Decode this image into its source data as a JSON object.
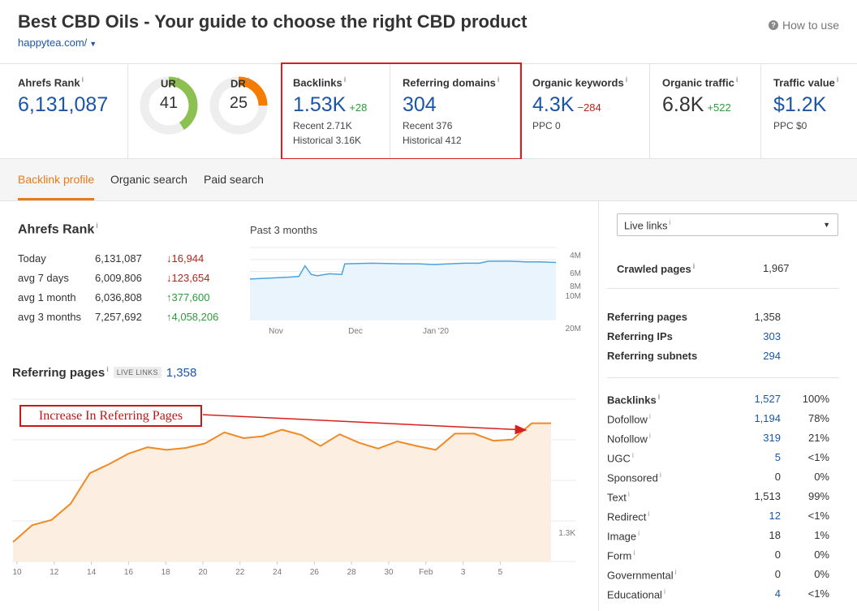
{
  "header": {
    "title": "Best CBD Oils - Your guide to choose the right CBD product",
    "domain": "happytea.com/",
    "how_to_use": "How to use"
  },
  "metrics": {
    "ahrefs_rank": {
      "label": "Ahrefs Rank",
      "value": "6,131,087"
    },
    "ur": {
      "label": "UR",
      "value": "41",
      "fraction": 0.41,
      "color": "#8cc152"
    },
    "dr": {
      "label": "DR",
      "value": "25",
      "fraction": 0.25,
      "color": "#f57c00"
    },
    "backlinks": {
      "label": "Backlinks",
      "value": "1.53K",
      "delta": "+28",
      "recent": "Recent 2.71K",
      "historical": "Historical 3.16K"
    },
    "referring_domains": {
      "label": "Referring domains",
      "value": "304",
      "recent": "Recent 376",
      "historical": "Historical 412"
    },
    "organic_keywords": {
      "label": "Organic keywords",
      "value": "4.3K",
      "delta": "−284",
      "ppc": "PPC 0"
    },
    "organic_traffic": {
      "label": "Organic traffic",
      "value": "6.8K",
      "delta": "+522"
    },
    "traffic_value": {
      "label": "Traffic value",
      "value": "$1.2K",
      "ppc": "PPC $0"
    }
  },
  "tabs": [
    {
      "label": "Backlink profile",
      "active": true
    },
    {
      "label": "Organic search",
      "active": false
    },
    {
      "label": "Paid search",
      "active": false
    }
  ],
  "rank_panel": {
    "title": "Ahrefs Rank",
    "rows": [
      {
        "period": "Today",
        "rank": "6,131,087",
        "change": "↓16,944",
        "direction": "down"
      },
      {
        "period": "avg 7 days",
        "rank": "6,009,806",
        "change": "↓123,654",
        "direction": "down"
      },
      {
        "period": "avg 1 month",
        "rank": "6,036,808",
        "change": "↑377,600",
        "direction": "up"
      },
      {
        "period": "avg 3 months",
        "rank": "7,257,692",
        "change": "↑4,058,206",
        "direction": "up"
      }
    ],
    "chart_caption": "Past 3 months"
  },
  "referring_pages": {
    "title": "Referring pages",
    "badge": "LIVE LINKS",
    "count": "1,358",
    "annotation": "Increase In Referring Pages"
  },
  "chart_data": [
    {
      "type": "area",
      "title": "Past 3 months",
      "x_ticks": [
        "Nov",
        "Dec",
        "Jan '20"
      ],
      "y_ticks": [
        "4M",
        "6M",
        "8M",
        "10M",
        "20M"
      ],
      "y_scale": "inverted",
      "x": [
        0,
        0.04,
        0.09,
        0.13,
        0.16,
        0.18,
        0.2,
        0.22,
        0.26,
        0.3,
        0.31,
        0.4,
        0.5,
        0.55,
        0.6,
        0.7,
        0.75,
        0.78,
        0.85,
        0.9,
        0.95,
        1.0
      ],
      "values": [
        7.3,
        7.2,
        7.1,
        7.0,
        6.9,
        5.3,
        6.6,
        6.8,
        6.5,
        6.6,
        5.0,
        4.9,
        5.0,
        5.0,
        5.1,
        4.9,
        4.9,
        4.6,
        4.6,
        4.7,
        4.7,
        4.8
      ],
      "color": "#4aa3df",
      "grid": true
    },
    {
      "type": "area",
      "title": "Referring pages",
      "x_ticks": [
        "10",
        "12",
        "14",
        "16",
        "18",
        "20",
        "22",
        "24",
        "26",
        "28",
        "30",
        "Feb",
        "3",
        "5"
      ],
      "y_ticks": [
        "1.3K"
      ],
      "values": [
        1220,
        1246,
        1254,
        1279,
        1326,
        1340,
        1356,
        1366,
        1362,
        1365,
        1372,
        1389,
        1380,
        1383,
        1393,
        1385,
        1368,
        1386,
        1373,
        1364,
        1375,
        1368,
        1362,
        1387,
        1387,
        1376,
        1378,
        1403,
        1403
      ],
      "color": "#f08a24",
      "fill": "#fdeee2",
      "grid": true
    }
  ],
  "right_panel": {
    "live_select": "Live links",
    "crawled": {
      "label": "Crawled pages",
      "value": "1,967"
    },
    "group1": [
      {
        "label": "Referring pages",
        "value": "1,358",
        "link": false
      },
      {
        "label": "Referring IPs",
        "value": "303",
        "link": true
      },
      {
        "label": "Referring subnets",
        "value": "294",
        "link": true
      }
    ],
    "backlinks_header": {
      "label": "Backlinks",
      "value": "1,527",
      "pct": "100%"
    },
    "group2": [
      {
        "label": "Dofollow",
        "value": "1,194",
        "pct": "78%",
        "link": true
      },
      {
        "label": "Nofollow",
        "value": "319",
        "pct": "21%",
        "link": true
      },
      {
        "label": "UGC",
        "value": "5",
        "pct": "<1%",
        "link": true
      },
      {
        "label": "Sponsored",
        "value": "0",
        "pct": "0%",
        "link": false
      },
      {
        "label": "Text",
        "value": "1,513",
        "pct": "99%",
        "link": false
      },
      {
        "label": "Redirect",
        "value": "12",
        "pct": "<1%",
        "link": true
      },
      {
        "label": "Image",
        "value": "18",
        "pct": "1%",
        "link": false
      },
      {
        "label": "Form",
        "value": "0",
        "pct": "0%",
        "link": false
      },
      {
        "label": "Governmental",
        "value": "0",
        "pct": "0%",
        "link": false
      },
      {
        "label": "Educational",
        "value": "4",
        "pct": "<1%",
        "link": true
      }
    ]
  }
}
